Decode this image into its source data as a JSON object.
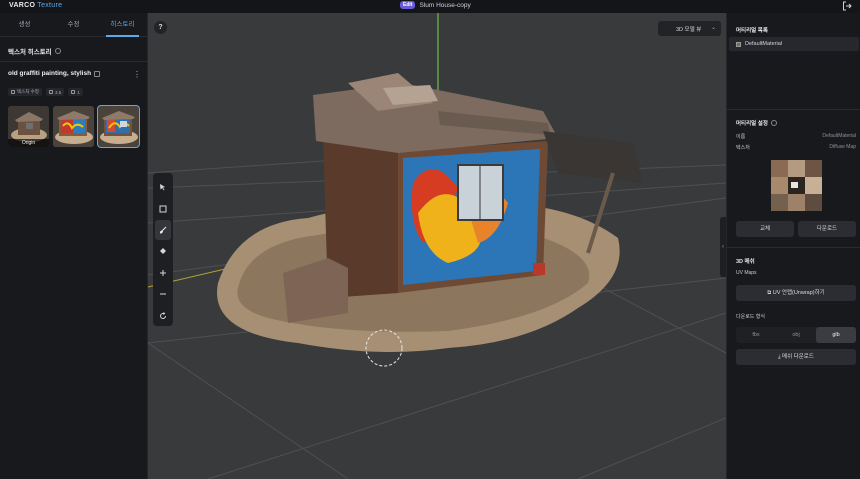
{
  "app": {
    "brand": "VARCO",
    "product": "Texture"
  },
  "document": {
    "badge": "Edit",
    "title": "Slum House-copy"
  },
  "left_panel": {
    "tabs": [
      {
        "label": "생성",
        "active": false
      },
      {
        "label": "수정",
        "active": false
      },
      {
        "label": "히스토리",
        "active": true
      }
    ],
    "section_title": "텍스처 히스토리",
    "prompt": "old graffiti painting, stylish",
    "meta": {
      "mode": "텍스처 수정",
      "strength": "3.5",
      "count": "1"
    },
    "thumbnails": [
      {
        "label": "Origin",
        "selected": false
      },
      {
        "label": "",
        "selected": false
      },
      {
        "label": "",
        "selected": true
      }
    ]
  },
  "viewport": {
    "help": "?",
    "view_mode": "3D 모델 뷰",
    "tools": [
      "select-icon",
      "box-select-icon",
      "brush-icon",
      "eraser-icon",
      "zoom-in-icon",
      "zoom-out-icon",
      "reset-icon"
    ],
    "active_tool": "brush-icon",
    "background_color": "#393a3c"
  },
  "right_panel": {
    "material_list_title": "머티리얼 목록",
    "material_item": "DefaultMaterial",
    "material_settings_title": "머티리얼 설정",
    "name_key": "이름",
    "name_value": "DefaultMaterial",
    "texture_key": "텍스처",
    "texture_value": "Diffuse Map",
    "replace_button": "교체",
    "download_button": "다운로드",
    "section_3d_title": "3D 메쉬",
    "uv_maps_label": "UV Maps",
    "uv_unwrap_button": "UV 언랩(Unwrap)하기",
    "download_format_label": "다운로드 형식",
    "formats": [
      {
        "label": "fbx",
        "active": false
      },
      {
        "label": "obj",
        "active": false
      },
      {
        "label": "glb",
        "active": true
      }
    ],
    "mesh_download_button": "메쉬 다운로드"
  },
  "colors": {
    "accent": "#5ea8e8",
    "badge": "#6a5ad8"
  }
}
